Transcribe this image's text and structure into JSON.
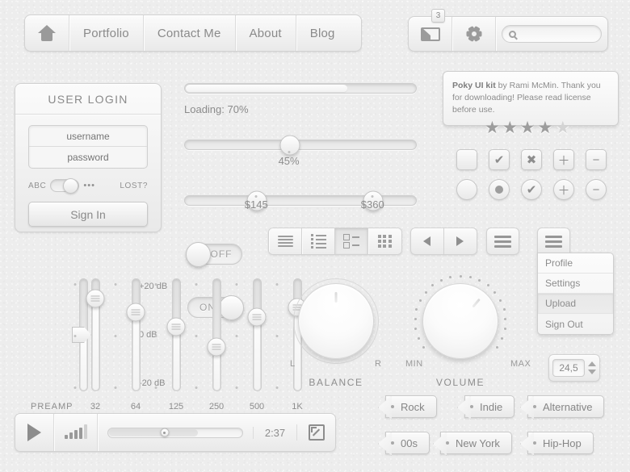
{
  "nav": {
    "home_icon": "home-icon",
    "items": [
      {
        "label": "Portfolio"
      },
      {
        "label": "Contact Me"
      },
      {
        "label": "About"
      },
      {
        "label": "Blog"
      }
    ]
  },
  "toolbar": {
    "mail_icon": "envelope-icon",
    "mail_badge": "3",
    "gear_icon": "gear-icon",
    "search_icon": "search-icon",
    "search_value": "",
    "search_placeholder": ""
  },
  "login": {
    "title": "USER LOGIN",
    "username_placeholder": "username",
    "username_value": "",
    "password_placeholder": "password",
    "password_value": "",
    "toggle_left_label": "ABC",
    "toggle_right_label": "•••",
    "lost_label": "LOST?",
    "submit_label": "Sign In"
  },
  "progress": {
    "label": "Loading: 70%",
    "percent": 70
  },
  "slider_single": {
    "value_label": "45%",
    "percent": 45
  },
  "slider_range": {
    "low_label": "$145",
    "high_label": "$360",
    "low_percent": 31,
    "high_percent": 81
  },
  "tooltip": {
    "strong": "Poky UI kit",
    "text": " by Rami McMin. Thank you for downloading! Please read license before use."
  },
  "rating": {
    "filled": 4,
    "total": 5,
    "glyph": "★"
  },
  "checkboxes": [
    {
      "name": "checkbox-empty",
      "glyph": ""
    },
    {
      "name": "checkbox-checked",
      "glyph": "✔"
    },
    {
      "name": "checkbox-cross",
      "glyph": "✖"
    },
    {
      "name": "checkbox-plus",
      "glyph": "＋"
    },
    {
      "name": "checkbox-minus",
      "glyph": "−"
    }
  ],
  "radios": [
    {
      "name": "radio-empty",
      "glyph": ""
    },
    {
      "name": "radio-selected",
      "glyph": "dot"
    },
    {
      "name": "radio-checked",
      "glyph": "✔"
    },
    {
      "name": "radio-plus",
      "glyph": "＋"
    },
    {
      "name": "radio-minus",
      "glyph": "−"
    }
  ],
  "toggles": {
    "off_label": "OFF",
    "on_label": "ON"
  },
  "view_modes": [
    {
      "name": "view-list",
      "active": false
    },
    {
      "name": "view-bullet-list",
      "active": false
    },
    {
      "name": "view-grid-list",
      "active": true
    },
    {
      "name": "view-grid",
      "active": false
    }
  ],
  "pager": {
    "prev_icon": "arrow-left-icon",
    "next_icon": "arrow-right-icon",
    "menu_icon": "hamburger-icon"
  },
  "menu": {
    "items": [
      {
        "label": "Profile",
        "selected": false
      },
      {
        "label": "Settings",
        "selected": false
      },
      {
        "label": "Upload",
        "selected": true
      },
      {
        "label": "Sign Out",
        "selected": false
      }
    ]
  },
  "equalizer": {
    "db_labels": [
      "+20 dB",
      "0 dB",
      "-20 dB"
    ],
    "preamp_label": "PREAMP",
    "preamp_percent": 50,
    "bands": [
      {
        "label": "32",
        "percent": 82
      },
      {
        "label": "64",
        "percent": 70
      },
      {
        "label": "125",
        "percent": 57
      },
      {
        "label": "250",
        "percent": 39
      },
      {
        "label": "500",
        "percent": 66
      },
      {
        "label": "1K",
        "percent": 74
      }
    ]
  },
  "knobs": [
    {
      "name": "BALANCE",
      "min_label": "L",
      "max_label": "R",
      "angle": 0
    },
    {
      "name": "VOLUME",
      "min_label": "MIN",
      "max_label": "MAX",
      "angle": 40
    }
  ],
  "stepper": {
    "value": "24,5",
    "up_icon": "triangle-up-icon",
    "down_icon": "triangle-down-icon"
  },
  "tags": [
    {
      "label": "Rock"
    },
    {
      "label": "Indie"
    },
    {
      "label": "Alternative"
    },
    {
      "label": "00s"
    },
    {
      "label": "New York"
    },
    {
      "label": "Hip-Hop"
    }
  ],
  "player": {
    "play_icon": "play-icon",
    "volume_icon": "volume-bars-icon",
    "time": "2:37",
    "progress_percent": 42,
    "buffer_percent": 66,
    "fullscreen_icon": "fullscreen-icon"
  }
}
